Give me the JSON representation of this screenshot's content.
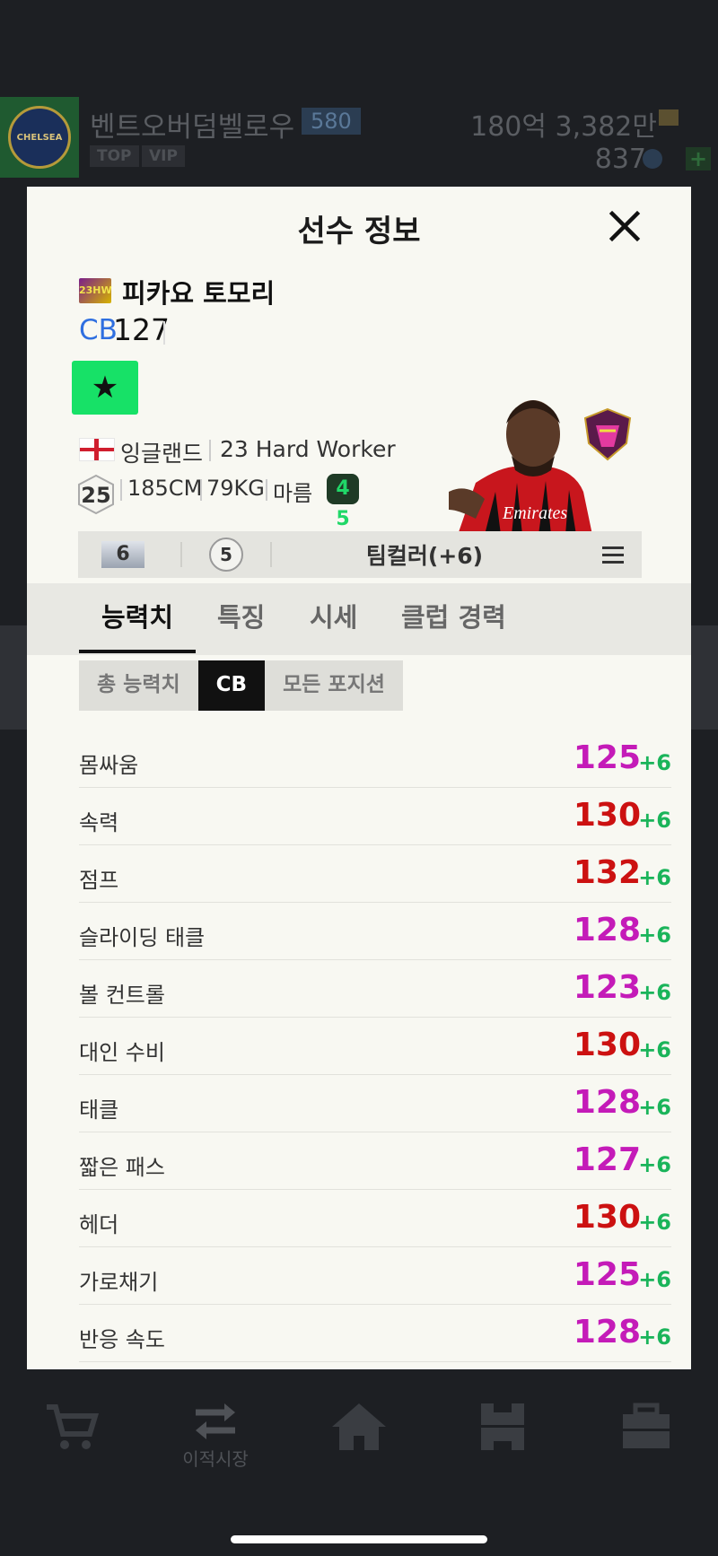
{
  "background": {
    "team_name": "벤트오버덤벨로우",
    "team_level": "580",
    "tags": [
      "TOP",
      "VIP"
    ],
    "money": "180억 3,382만",
    "points": "837",
    "club_crest_text": "CHELSEA"
  },
  "bottom_nav": {
    "items": [
      {
        "icon": "cart-icon",
        "label": ""
      },
      {
        "icon": "transfer-arrows-icon",
        "label": "이적시장"
      },
      {
        "icon": "home-icon",
        "label": ""
      },
      {
        "icon": "pitch-icon",
        "label": ""
      },
      {
        "icon": "toolbox-icon",
        "label": ""
      }
    ]
  },
  "modal": {
    "title": "선수 정보",
    "player": {
      "season_badge": "23HW",
      "name": "피카요 토모리",
      "position": "CB",
      "ovr": "127",
      "favorite_icon": "★",
      "nation": "잉글랜드",
      "class": "23 Hard Worker",
      "age": "25",
      "height": "185CM",
      "weight": "79KG",
      "body_type": "마름",
      "skill_moves": "4 5"
    },
    "enhance": {
      "grade": "6",
      "level": "5",
      "team_color": "팀컬러(+6)"
    },
    "tabs": [
      "능력치",
      "특징",
      "시세",
      "클럽 경력"
    ],
    "segments": [
      "총 능력치",
      "CB",
      "모든 포지션"
    ],
    "stats": [
      {
        "name": "몸싸움",
        "value": "125",
        "bonus": "+6",
        "color": "#c41bb8"
      },
      {
        "name": "속력",
        "value": "130",
        "bonus": "+6",
        "color": "#cc1111"
      },
      {
        "name": "점프",
        "value": "132",
        "bonus": "+6",
        "color": "#cc1111"
      },
      {
        "name": "슬라이딩 태클",
        "value": "128",
        "bonus": "+6",
        "color": "#c41bb8"
      },
      {
        "name": "볼 컨트롤",
        "value": "123",
        "bonus": "+6",
        "color": "#c41bb8"
      },
      {
        "name": "대인 수비",
        "value": "130",
        "bonus": "+6",
        "color": "#cc1111"
      },
      {
        "name": "태클",
        "value": "128",
        "bonus": "+6",
        "color": "#c41bb8"
      },
      {
        "name": "짧은 패스",
        "value": "127",
        "bonus": "+6",
        "color": "#c41bb8"
      },
      {
        "name": "헤더",
        "value": "130",
        "bonus": "+6",
        "color": "#cc1111"
      },
      {
        "name": "가로채기",
        "value": "125",
        "bonus": "+6",
        "color": "#c41bb8"
      },
      {
        "name": "반응 속도",
        "value": "128",
        "bonus": "+6",
        "color": "#c41bb8"
      }
    ]
  }
}
